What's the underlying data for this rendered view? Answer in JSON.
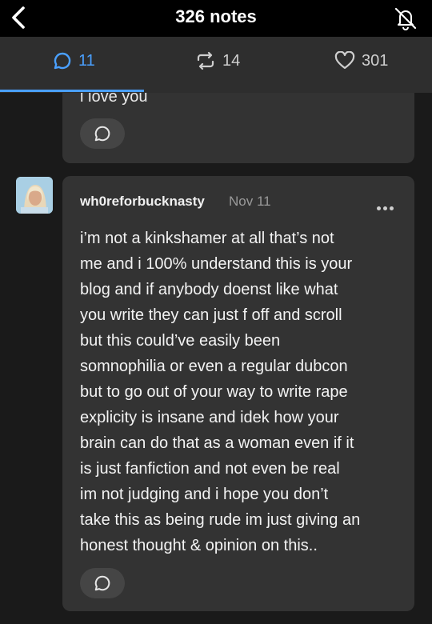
{
  "header": {
    "title": "326 notes",
    "back_icon": "chevron-left-icon",
    "mute_icon": "bell-off-icon"
  },
  "tabs": [
    {
      "label": "11",
      "icon": "reply-bubble-icon",
      "active": true
    },
    {
      "label": "14",
      "icon": "reblog-icon",
      "active": false
    },
    {
      "label": "301",
      "icon": "heart-icon",
      "active": false
    }
  ],
  "colors": {
    "accent": "#4aa0ff",
    "background": "#1a1a1a",
    "card": "#333333"
  },
  "notes": [
    {
      "truncated_text": "i love you",
      "reply_icon": "reply-bubble-icon"
    },
    {
      "username": "wh0reforbucknasty",
      "date": "Nov 11",
      "more_icon": "more-dots-icon",
      "lines": [
        "i’m not a kinkshamer at all that’s not",
        "me and i 100% understand this is your",
        "blog and if anybody doenst like what",
        "you write they can just f off and scroll",
        "but this could’ve easily been",
        "somnophilia or even a regular dubcon",
        "but to go out of your way to write rape",
        "explicity is insane and idek how your",
        "brain can do that as a woman even if it",
        "is just fanfiction and not even be real",
        "im not judging and i hope you don’t",
        "take this as being rude im just giving an",
        "honest thought & opinion on this.."
      ],
      "reply_icon": "reply-bubble-icon"
    }
  ]
}
